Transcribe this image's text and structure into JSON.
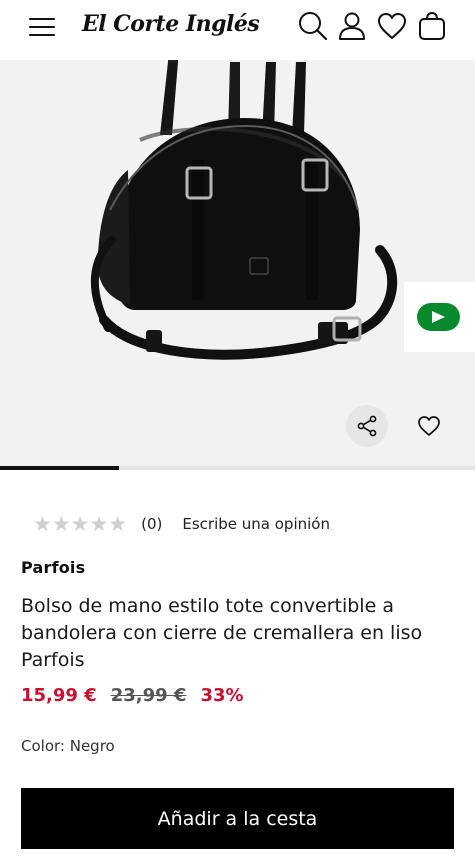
{
  "header": {
    "logo_text": "El Corte Inglés",
    "icons": [
      "menu-icon",
      "search-icon",
      "user-icon",
      "heart-icon",
      "bag-icon"
    ]
  },
  "gallery": {
    "image_alt": "black bag",
    "progress_fraction": 0.25,
    "icons": [
      "share-icon",
      "heart-icon",
      "play-icon"
    ]
  },
  "rating": {
    "stars": "★★★★★",
    "count": "(0)",
    "write_review": "Escribe una opinión"
  },
  "product": {
    "brand": "Parfois",
    "title": "Bolso de mano estilo tote convertible a bandolera con cierre de cremallera en liso Parfois",
    "price_now": "15,99 €",
    "price_old": "23,99 €",
    "discount": "33%",
    "color_label": "Color: Negro"
  },
  "actions": {
    "add_to_cart": "Añadir a la cesta"
  },
  "colors": {
    "sale_red": "#c8102e",
    "button_black": "#000000",
    "ai_green": "#0a8a2f"
  }
}
